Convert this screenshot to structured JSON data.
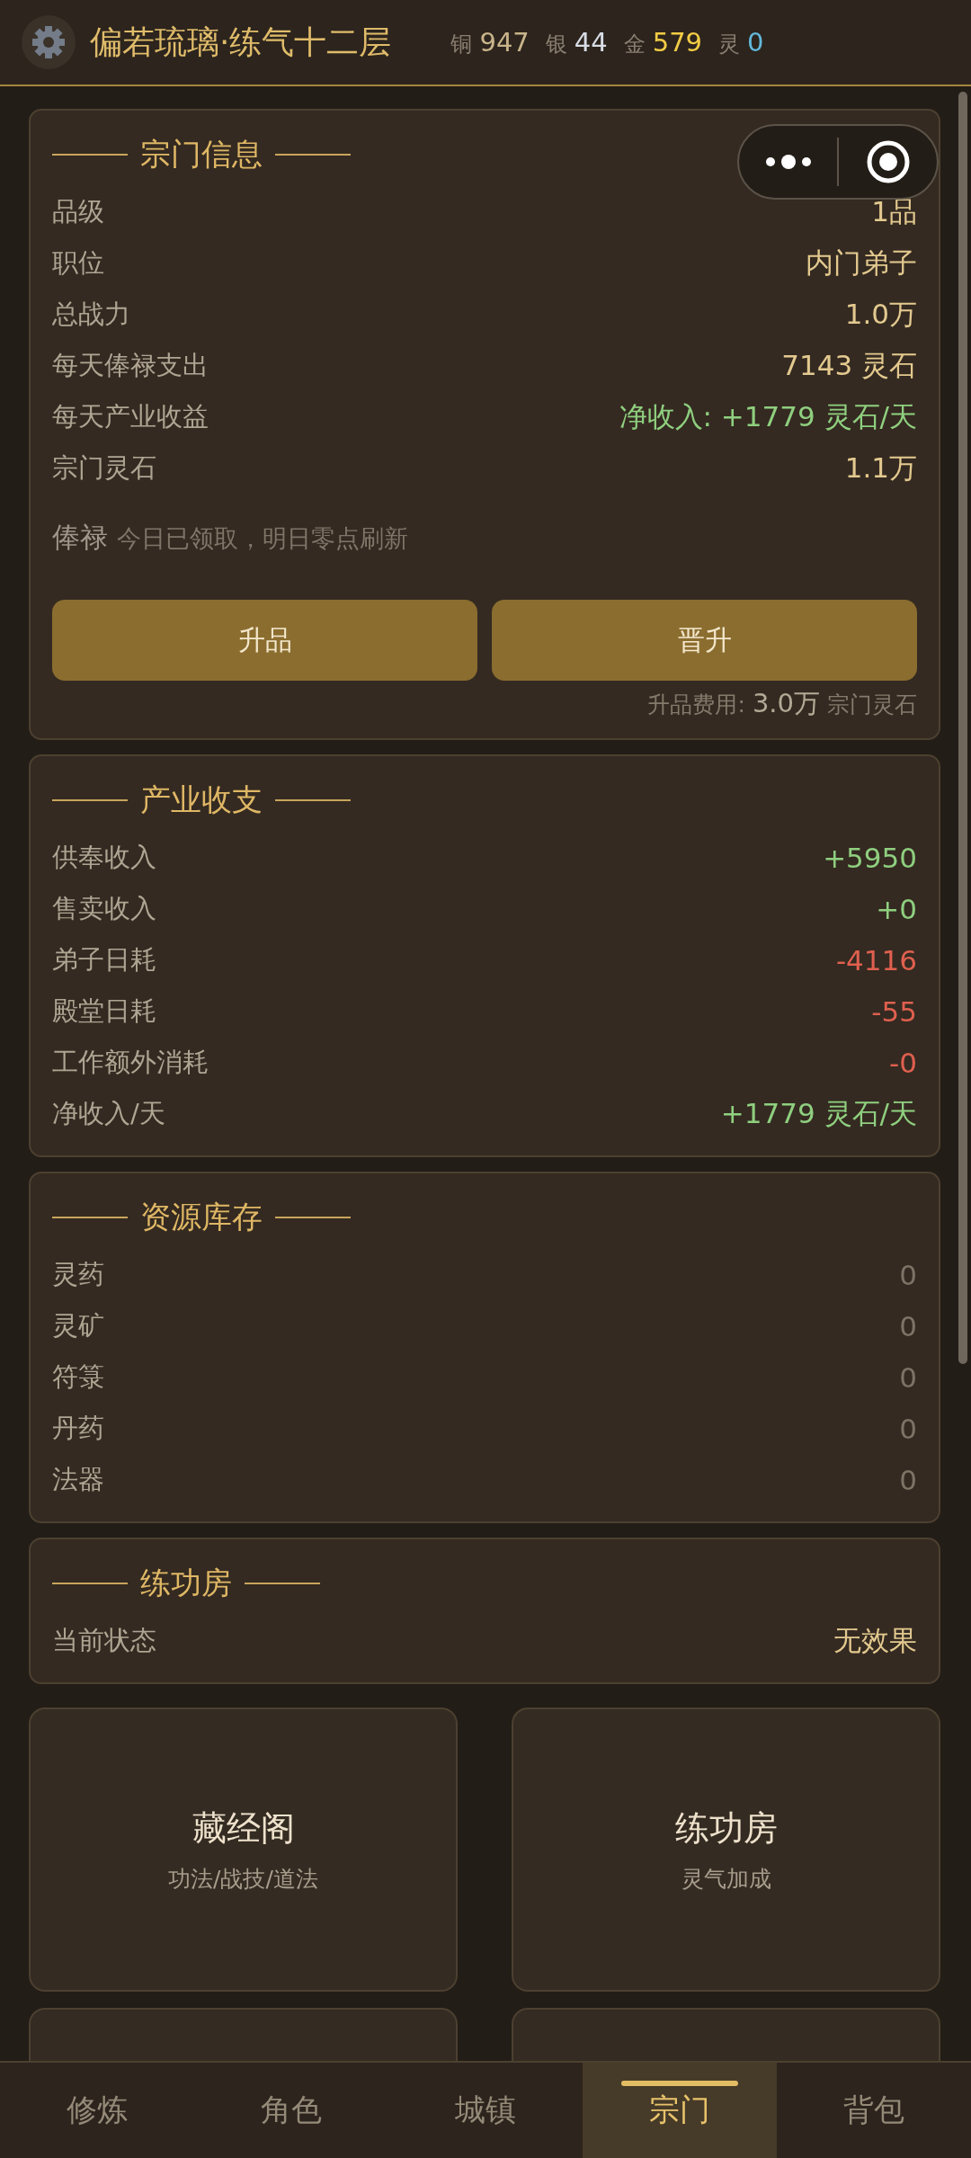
{
  "header": {
    "title": "偏若琉璃·练气十二层",
    "currencies": [
      {
        "label": "铜",
        "value": "947",
        "color": "#c9b48a"
      },
      {
        "label": "银",
        "value": "44",
        "color": "#d8dde6"
      },
      {
        "label": "金",
        "value": "579",
        "color": "#f2cc45"
      },
      {
        "label": "灵",
        "value": "0",
        "color": "#62b8dc"
      }
    ]
  },
  "sections": [
    {
      "title": "宗门信息",
      "rows": [
        {
          "label": "品级",
          "value": "1品",
          "color": "#e3c98f"
        },
        {
          "label": "职位",
          "value": "内门弟子",
          "color": "#e3c98f"
        },
        {
          "label": "总战力",
          "value": "1.0万",
          "color": "#e3c98f"
        },
        {
          "label": "每天俸禄支出",
          "value": "7143 灵石",
          "color": "#e3c98f"
        },
        {
          "label": "每天产业收益",
          "value": "净收入: +1779 灵石/天",
          "color": "#8fcf7f"
        },
        {
          "label": "宗门灵石",
          "value": "1.1万",
          "color": "#e3c98f"
        }
      ],
      "note": {
        "label": "俸禄",
        "text": "今日已领取，明日零点刷新"
      },
      "buttons": [
        "升品",
        "晋升"
      ],
      "cost": {
        "label": "升品费用:",
        "value": "3.0万",
        "unit": "宗门灵石"
      }
    },
    {
      "title": "产业收支",
      "rows": [
        {
          "label": "供奉收入",
          "value": "+5950",
          "color": "#8fcf7f"
        },
        {
          "label": "售卖收入",
          "value": "+0",
          "color": "#8fcf7f"
        },
        {
          "label": "弟子日耗",
          "value": "-4116",
          "color": "#e0604f"
        },
        {
          "label": "殿堂日耗",
          "value": "-55",
          "color": "#e0604f"
        },
        {
          "label": "工作额外消耗",
          "value": "-0",
          "color": "#e0604f"
        },
        {
          "label": "净收入/天",
          "value": "+1779 灵石/天",
          "color": "#8fcf7f"
        }
      ]
    },
    {
      "title": "资源库存",
      "rows": [
        {
          "label": "灵药",
          "value": "0",
          "color": "#7d7466"
        },
        {
          "label": "灵矿",
          "value": "0",
          "color": "#7d7466"
        },
        {
          "label": "符箓",
          "value": "0",
          "color": "#7d7466"
        },
        {
          "label": "丹药",
          "value": "0",
          "color": "#7d7466"
        },
        {
          "label": "法器",
          "value": "0",
          "color": "#7d7466"
        }
      ]
    },
    {
      "title": "练功房",
      "rows": [
        {
          "label": "当前状态",
          "value": "无效果",
          "color": "#e3c98f"
        }
      ]
    }
  ],
  "tiles": [
    {
      "kind": "feature",
      "title": "藏经阁",
      "subtitle": "功法/战技/道法"
    },
    {
      "kind": "feature",
      "title": "练功房",
      "subtitle": "灵气加成"
    },
    {
      "kind": "empty"
    },
    {
      "kind": "empty"
    }
  ],
  "tabs": [
    {
      "label": "修炼",
      "selected": false
    },
    {
      "label": "角色",
      "selected": false
    },
    {
      "label": "城镇",
      "selected": false
    },
    {
      "label": "宗门",
      "selected": true
    },
    {
      "label": "背包",
      "selected": false
    }
  ]
}
